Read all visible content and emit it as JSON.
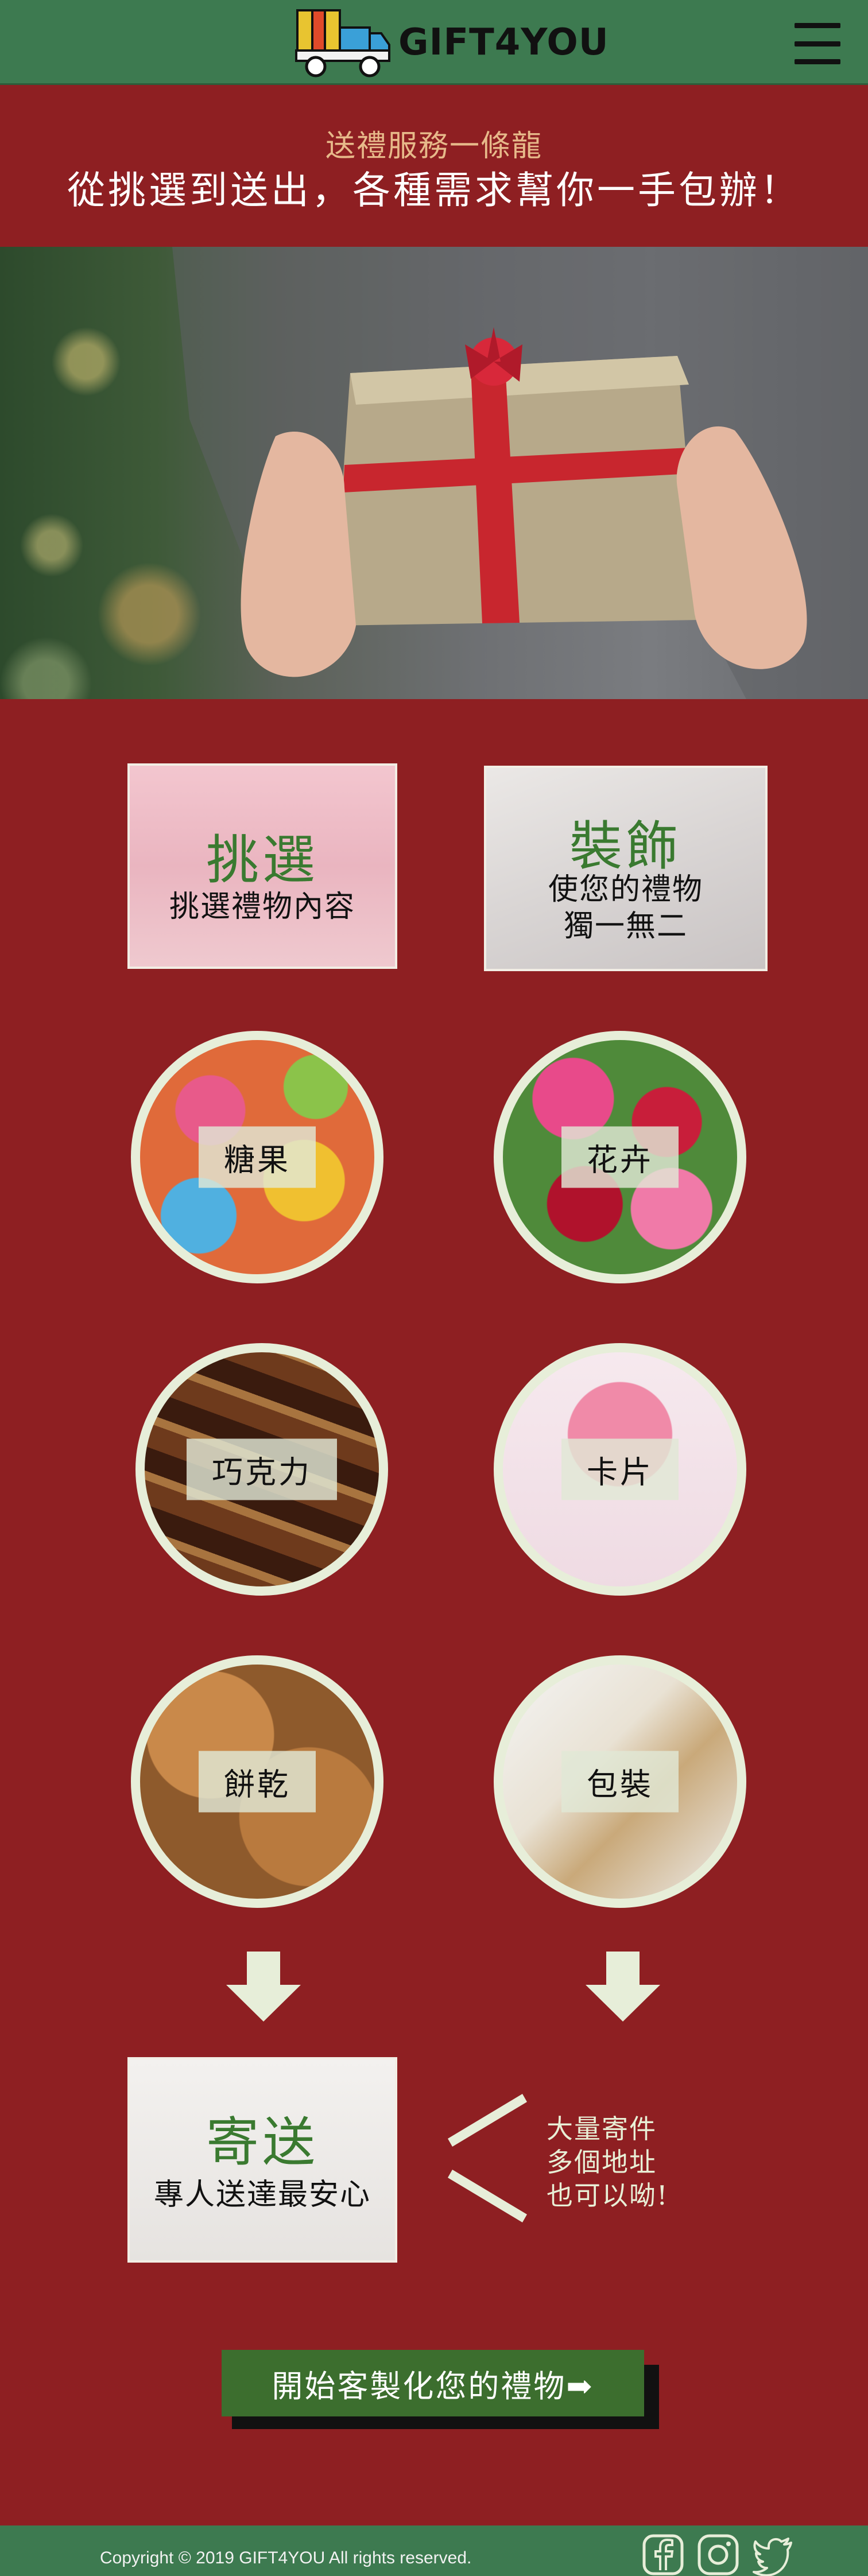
{
  "header": {
    "brand": "GIFT4YOU",
    "logo_icon": "gift-truck-icon",
    "menu_icon": "hamburger-icon"
  },
  "banner": {
    "subtitle": "送禮服務一條龍",
    "title": "從挑選到送出，各種需求幫你一手包辦！"
  },
  "steps": {
    "select": {
      "title": "挑選",
      "desc": "挑選禮物內容"
    },
    "decorate": {
      "title": "裝飾",
      "desc_line1": "使您的禮物",
      "desc_line2": "獨一無二"
    },
    "send": {
      "title": "寄送",
      "desc": "專人送達最安心"
    }
  },
  "categories": [
    {
      "label": "糖果"
    },
    {
      "label": "花卉"
    },
    {
      "label": "巧克力"
    },
    {
      "label": "卡片"
    },
    {
      "label": "餅乾"
    },
    {
      "label": "包裝"
    }
  ],
  "note": {
    "line1": "大量寄件",
    "line2": "多個地址",
    "line3": "也可以呦!"
  },
  "cta": {
    "label": "開始客製化您的禮物➡"
  },
  "footer": {
    "copyright": "Copyright © 2019 GIFT4YOU All rights reserved.",
    "social": [
      "facebook-icon",
      "instagram-icon",
      "twitter-icon"
    ]
  },
  "colors": {
    "header_green": "#3d7a50",
    "page_red": "#8e1f22",
    "accent_green": "#3a7a30",
    "pale_green": "#e7eed9",
    "cta_green": "#3c6e2e"
  }
}
